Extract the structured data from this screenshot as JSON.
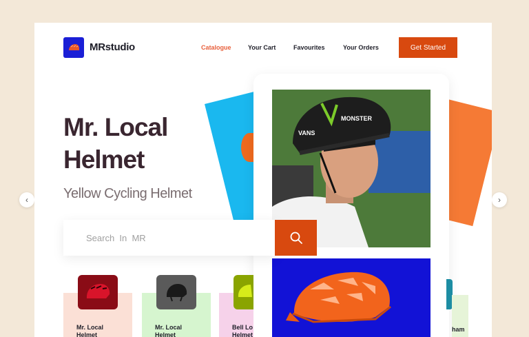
{
  "brand": {
    "name": "MRstudio",
    "logo_icon": "helmet-icon"
  },
  "nav": {
    "items": [
      {
        "label": "Catalogue",
        "active": true
      },
      {
        "label": "Your Cart",
        "active": false
      },
      {
        "label": "Favourites",
        "active": false
      },
      {
        "label": "Your Orders",
        "active": false
      }
    ],
    "cta_label": "Get Started"
  },
  "hero": {
    "title_line1": "Mr. Local",
    "title_line2": "Helmet",
    "subtitle": "Yellow Cycling Helmet"
  },
  "search": {
    "placeholder": "Search  In  MR",
    "icon": "search-icon"
  },
  "products": [
    {
      "label_line1": "Mr. Local",
      "label_line2": "Helmet",
      "card_color": "#fbe0d6",
      "thumb_color": "#8a0c16"
    },
    {
      "label_line1": "Mr. Local",
      "label_line2": "Helmet",
      "card_color": "#d6f5cf",
      "thumb_color": "#5a5a5a"
    },
    {
      "label_line1": "Bell Lo",
      "label_line2": "Helmet",
      "card_color": "#f6d2ea",
      "thumb_color": "#8aa400"
    }
  ],
  "right_product_label": "ham",
  "colors": {
    "accent": "#d8490f",
    "nav_active": "#e8603c",
    "background": "#f3e8d8",
    "tile_blue": "#1212d6"
  },
  "carousel": {
    "prev_icon": "chevron-left-icon",
    "next_icon": "chevron-right-icon"
  }
}
